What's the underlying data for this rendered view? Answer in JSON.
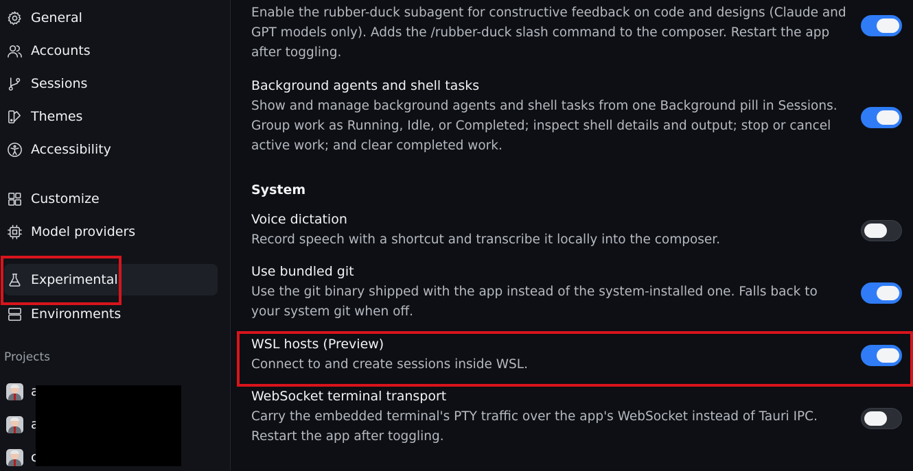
{
  "sidebar": {
    "items": [
      {
        "label": "General",
        "icon": "gear-icon"
      },
      {
        "label": "Accounts",
        "icon": "users-icon"
      },
      {
        "label": "Sessions",
        "icon": "branch-icon"
      },
      {
        "label": "Themes",
        "icon": "palette-icon"
      },
      {
        "label": "Accessibility",
        "icon": "accessibility-icon"
      },
      {
        "label": "Customize",
        "icon": "grid-plus-icon"
      },
      {
        "label": "Model providers",
        "icon": "chip-icon"
      },
      {
        "label": "Experimental",
        "icon": "flask-icon",
        "active": true
      },
      {
        "label": "Environments",
        "icon": "server-icon"
      }
    ],
    "projects_label": "Projects",
    "projects": [
      {
        "name": "a"
      },
      {
        "name": "a"
      },
      {
        "name": "c"
      }
    ]
  },
  "main": {
    "settings_top": [
      {
        "title": "",
        "desc": "Enable the rubber-duck subagent for constructive feedback on code and designs (Claude and GPT models only). Adds the /rubber-duck slash command to the composer. Restart the app after toggling.",
        "enabled": true
      },
      {
        "title": "Background agents and shell tasks",
        "desc": "Show and manage background agents and shell tasks from one Background pill in Sessions. Group work as Running, Idle, or Completed; inspect shell details and output; stop or cancel active work; and clear completed work.",
        "enabled": true
      }
    ],
    "system_group": "System",
    "settings_system": [
      {
        "title": "Voice dictation",
        "desc": "Record speech with a shortcut and transcribe it locally into the composer.",
        "enabled": false
      },
      {
        "title": "Use bundled git",
        "desc": "Use the git binary shipped with the app instead of the system-installed one. Falls back to your system git when off.",
        "enabled": true
      },
      {
        "title": "WSL hosts (Preview)",
        "desc": "Connect to and create sessions inside WSL.",
        "enabled": true
      },
      {
        "title": "WebSocket terminal transport",
        "desc": "Carry the embedded terminal's PTY traffic over the app's WebSocket instead of Tauri IPC. Restart the app after toggling.",
        "enabled": false
      }
    ]
  },
  "colors": {
    "toggle_on": "#2f7cf6",
    "annotation": "#d8141c"
  }
}
